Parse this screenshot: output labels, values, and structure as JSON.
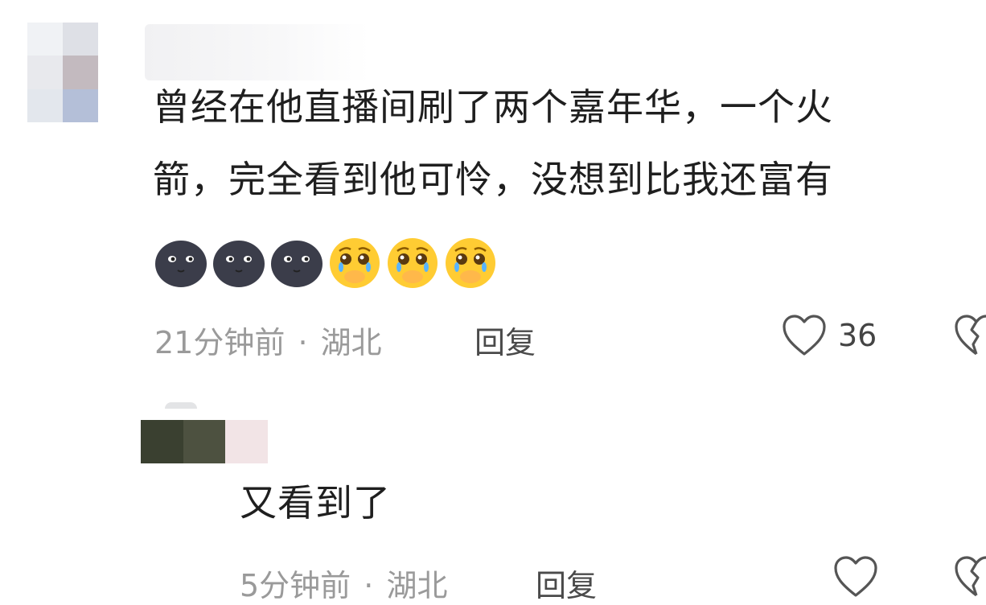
{
  "comments": [
    {
      "text_line1": "曾经在他直播间刷了两个嘉年华，一个火",
      "text_line2": "箭，完全看到他可怜，没想到比我还富有",
      "emojis": [
        "smirk-dark-face",
        "smirk-dark-face",
        "smirk-dark-face",
        "pleading-tears-face",
        "pleading-tears-face",
        "pleading-tears-face"
      ],
      "time": "21分钟前",
      "location": "湖北",
      "separator": "·",
      "reply_label": "回复",
      "like_count": "36"
    },
    {
      "text": "又看到了",
      "time": "5分钟前",
      "location": "湖北",
      "separator": "·",
      "reply_label": "回复"
    }
  ],
  "icons": {
    "like": "heart-outline-icon",
    "dislike": "broken-heart-icon"
  },
  "colors": {
    "text": "#1f1f1f",
    "meta": "#9a9a9a",
    "emoji_dark": "#3b3d4a",
    "emoji_yellow": "#ffcc33"
  }
}
